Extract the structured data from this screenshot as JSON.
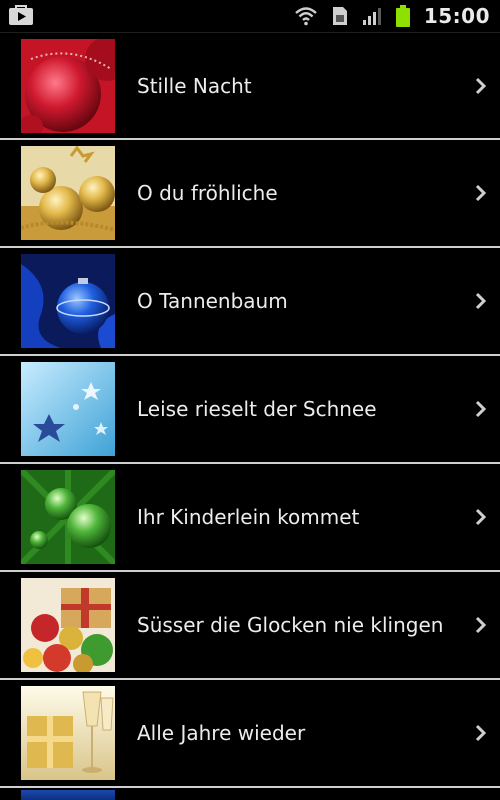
{
  "status_bar": {
    "time": "15:00",
    "icons": [
      "play-store-icon",
      "wifi-icon",
      "sim-card-icon",
      "signal-icon",
      "battery-icon"
    ]
  },
  "songs": [
    {
      "title": "Stille Nacht",
      "thumb": "red-ornament"
    },
    {
      "title": "O du fröhliche",
      "thumb": "gold-ornaments"
    },
    {
      "title": "O Tannenbaum",
      "thumb": "blue-ornament"
    },
    {
      "title": "Leise rieselt der Schnee",
      "thumb": "light-blue-stars"
    },
    {
      "title": "Ihr Kinderlein kommet",
      "thumb": "green-ornaments"
    },
    {
      "title": "Süsser die Glocken nie klingen",
      "thumb": "gifts-and-ornaments"
    },
    {
      "title": "Alle Jahre wieder",
      "thumb": "champagne-and-gift"
    }
  ],
  "colors": {
    "background": "#000000",
    "divider": "#cfcfcf",
    "text": "#ececec",
    "battery": "#8ee000"
  }
}
